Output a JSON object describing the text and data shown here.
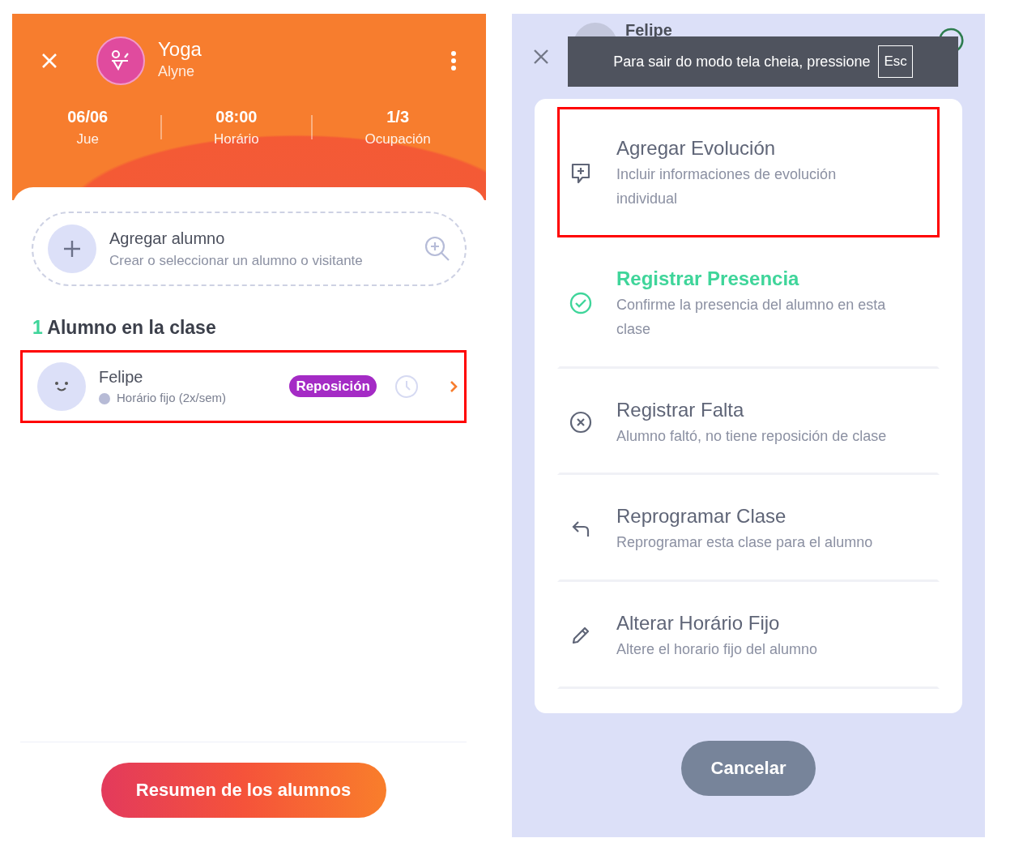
{
  "class_panel": {
    "title": "Yoga",
    "instructor": "Alyne",
    "stats": [
      {
        "value": "06/06",
        "label": "Jue"
      },
      {
        "value": "08:00",
        "label": "Horário"
      },
      {
        "value": "1/3",
        "label": "Ocupación"
      }
    ],
    "add_student": {
      "title": "Agregar alumno",
      "subtitle": "Crear o seleccionar un alumno o visitante"
    },
    "count": "1",
    "section_title": "Alumno en la clase",
    "students": [
      {
        "name": "Felipe",
        "plan": "Horário fijo (2x/sem)",
        "tag": "Reposición",
        "highlighted": true
      }
    ],
    "summary_button": "Resumen de los alumnos"
  },
  "actions_panel": {
    "student_name": "Felipe",
    "toast": {
      "text": "Para sair do modo tela cheia, pressione",
      "key": "Esc"
    },
    "options": [
      {
        "kind": "evolution",
        "title": "Agregar Evolución",
        "description": "Incluir informaciones de evolución individual",
        "color": "#5f6577",
        "highlighted": true
      },
      {
        "kind": "presence",
        "title": "Registrar Presencia",
        "description": "Confirme la presencia del alumno en esta clase",
        "color": "#3fd59a",
        "highlighted": false
      },
      {
        "kind": "absence",
        "title": "Registrar Falta",
        "description": "Alumno faltó, no tiene reposición de clase",
        "color": "#5f6577",
        "highlighted": false
      },
      {
        "kind": "reschedule",
        "title": "Reprogramar Clase",
        "description": "Reprogramar esta clase para el alumno",
        "color": "#5f6577",
        "highlighted": false
      },
      {
        "kind": "edit",
        "title": "Alterar Horário Fijo",
        "description": "Altere el horario fijo del alumno",
        "color": "#5f6577",
        "highlighted": false
      }
    ],
    "cancel_button": "Cancelar"
  }
}
